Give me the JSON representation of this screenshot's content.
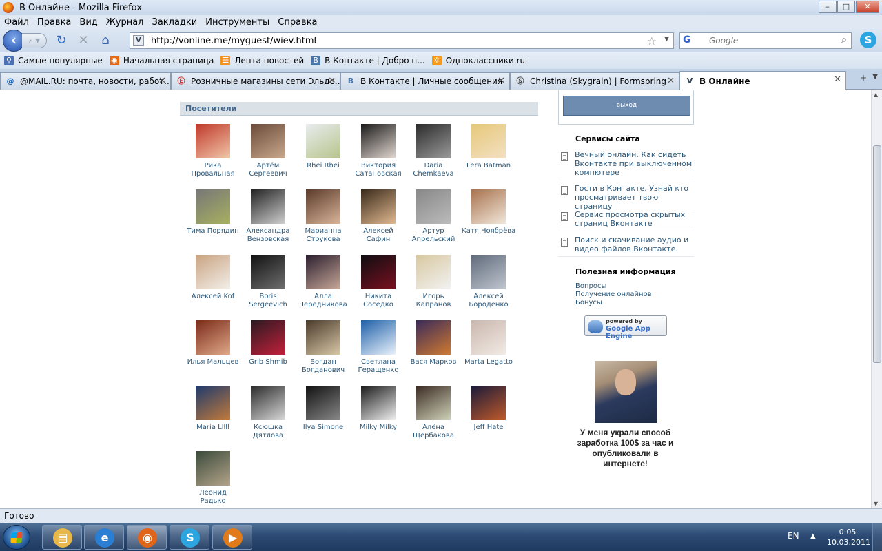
{
  "window": {
    "title": "В Онлайне - Mozilla Firefox"
  },
  "menu": [
    "Файл",
    "Правка",
    "Вид",
    "Журнал",
    "Закладки",
    "Инструменты",
    "Справка"
  ],
  "nav": {
    "url": "http://vonline.me/myguest/wiev.html",
    "search_placeholder": "Google"
  },
  "bookmarks": [
    {
      "label": "Самые популярные",
      "icon": "popular-icon",
      "color": "#4a72b3"
    },
    {
      "label": "Начальная страница",
      "icon": "firefox-icon",
      "color": "#e06a1a"
    },
    {
      "label": "Лента новостей",
      "icon": "rss-icon",
      "color": "#f29222"
    },
    {
      "label": "В Контакте | Добро п...",
      "icon": "vk-icon",
      "color": "#4a76a8"
    },
    {
      "label": "Одноклассники.ru",
      "icon": "odnoklassniki-icon",
      "color": "#f49a1a"
    }
  ],
  "tabs": [
    {
      "label": "@MAIL.RU: почта, новости, работ...",
      "icon": "@",
      "color": "#1565c0"
    },
    {
      "label": "Розничные магазины сети Эльдо...",
      "icon": "Ⓔ",
      "color": "#d32f2f"
    },
    {
      "label": "В Контакте | Личные сообщения",
      "icon": "B",
      "color": "#4a76a8"
    },
    {
      "label": "Christina (Skygrain) | Formspring",
      "icon": "Ⓢ",
      "color": "#444"
    },
    {
      "label": "В Онлайне",
      "icon": "V",
      "color": "#345",
      "active": true
    }
  ],
  "page": {
    "section_title": "Посетители",
    "visitors": [
      {
        "name": "Рика\nПровальная",
        "colors": [
          "#c0392b",
          "#f1c6a8"
        ]
      },
      {
        "name": "Артём\nСергеевич",
        "colors": [
          "#6b4a3a",
          "#c9a98c"
        ]
      },
      {
        "name": "Rhei Rhei",
        "colors": [
          "#e8ecef",
          "#b7c48a"
        ]
      },
      {
        "name": "Виктория\nСатановская",
        "colors": [
          "#1a1a1a",
          "#e2d7d0"
        ]
      },
      {
        "name": "Daria\nChemkaeva",
        "colors": [
          "#2b2b2b",
          "#9a9a9a"
        ]
      },
      {
        "name": "Lera Batman",
        "colors": [
          "#e6c87a",
          "#f3e0c2"
        ]
      },
      {
        "name": "Тима Порядин",
        "colors": [
          "#777",
          "#a8b060"
        ]
      },
      {
        "name": "Александра\nВензовская",
        "colors": [
          "#222",
          "#cfcfcf"
        ]
      },
      {
        "name": "Марианна\nСтрукова",
        "colors": [
          "#5a3a2a",
          "#d9b59a"
        ]
      },
      {
        "name": "Алексей Сафин",
        "colors": [
          "#3a2a1a",
          "#e0b890"
        ]
      },
      {
        "name": "Артур\nАпрельский",
        "colors": [
          "#888",
          "#bbb"
        ]
      },
      {
        "name": "Катя Ноябрёва",
        "colors": [
          "#a8724e",
          "#f1e7da"
        ]
      },
      {
        "name": "Алексей Kof",
        "colors": [
          "#c9a382",
          "#f3efe9"
        ]
      },
      {
        "name": "Boris Sergeevich",
        "colors": [
          "#111",
          "#6f6f6f"
        ]
      },
      {
        "name": "Алла\nЧередникова",
        "colors": [
          "#2a1e2e",
          "#c8a898"
        ]
      },
      {
        "name": "Никита\nСоседко",
        "colors": [
          "#0e0e12",
          "#7a1020"
        ]
      },
      {
        "name": "Игорь Капранов",
        "colors": [
          "#d8c8a0",
          "#f2f2f2"
        ]
      },
      {
        "name": "Алексей\nБороденко",
        "colors": [
          "#5f6a7a",
          "#c0c6cf"
        ]
      },
      {
        "name": "Илья Мальцев",
        "colors": [
          "#7a2a1a",
          "#e0a888"
        ]
      },
      {
        "name": "Grib Shmib",
        "colors": [
          "#2a1a22",
          "#c4203a"
        ]
      },
      {
        "name": "Богдан\nБогданович",
        "colors": [
          "#4a3a2a",
          "#d9c8a8"
        ]
      },
      {
        "name": "Светлана\nГеращенко",
        "colors": [
          "#1e5fa8",
          "#e9f2fb"
        ]
      },
      {
        "name": "Вася Марков",
        "colors": [
          "#3a2a5a",
          "#d07a30"
        ]
      },
      {
        "name": "Marta Legatto",
        "colors": [
          "#c9b7ad",
          "#f2eae5"
        ]
      },
      {
        "name": "Maria Lllll",
        "colors": [
          "#1e3a6e",
          "#c27a3a"
        ]
      },
      {
        "name": "Ксюшка\nДятлова",
        "colors": [
          "#2a2a2a",
          "#d8d8d8"
        ]
      },
      {
        "name": "Ilya Simone",
        "colors": [
          "#111",
          "#888"
        ]
      },
      {
        "name": "Milky Milky",
        "colors": [
          "#1a1a1a",
          "#efefef"
        ]
      },
      {
        "name": "Алёна\nЩербакова",
        "colors": [
          "#3a2a22",
          "#cfd2b8"
        ]
      },
      {
        "name": "Jeff Hate",
        "colors": [
          "#1a1a3a",
          "#c05a2a"
        ]
      },
      {
        "name": "Леонид Радько",
        "colors": [
          "#3a4a3a",
          "#b4a48a"
        ]
      }
    ]
  },
  "sidebar": {
    "logout_label": "выход",
    "services_title": "Сервисы сайта",
    "services": [
      "Вечный онлайн. Как сидеть Вконтакте при выключенном компютере",
      "Гости в Контакте. Узнай кто просматривает твою страницу",
      "Сервис просмотра скрытых страниц Вконтакте",
      "Поиск и скачивание аудио и видео файлов Вконтакте."
    ],
    "info_title": "Полезная информация",
    "info_links": [
      "Вопросы",
      "Получение онлайнов",
      "Бонусы"
    ],
    "badge": {
      "powered": "powered by",
      "engine": "Google App Engine"
    },
    "ad_text": "У меня украли способ заработка 100$ за час и опубликовали в интернете!"
  },
  "status": {
    "text": "Готово"
  },
  "taskbar": {
    "items": [
      {
        "icon": "explorer-icon",
        "glyph": "▤",
        "color": "#e8b84a"
      },
      {
        "icon": "ie-icon",
        "glyph": "e",
        "color": "#2a7fd4"
      },
      {
        "icon": "firefox-icon",
        "glyph": "◉",
        "color": "#e0641a",
        "active": true
      },
      {
        "icon": "skype-icon",
        "glyph": "S",
        "color": "#2ca5e0"
      },
      {
        "icon": "media-player-icon",
        "glyph": "▶",
        "color": "#e07a1a"
      }
    ],
    "lang": "EN",
    "time": "0:05",
    "date": "10.03.2011"
  }
}
